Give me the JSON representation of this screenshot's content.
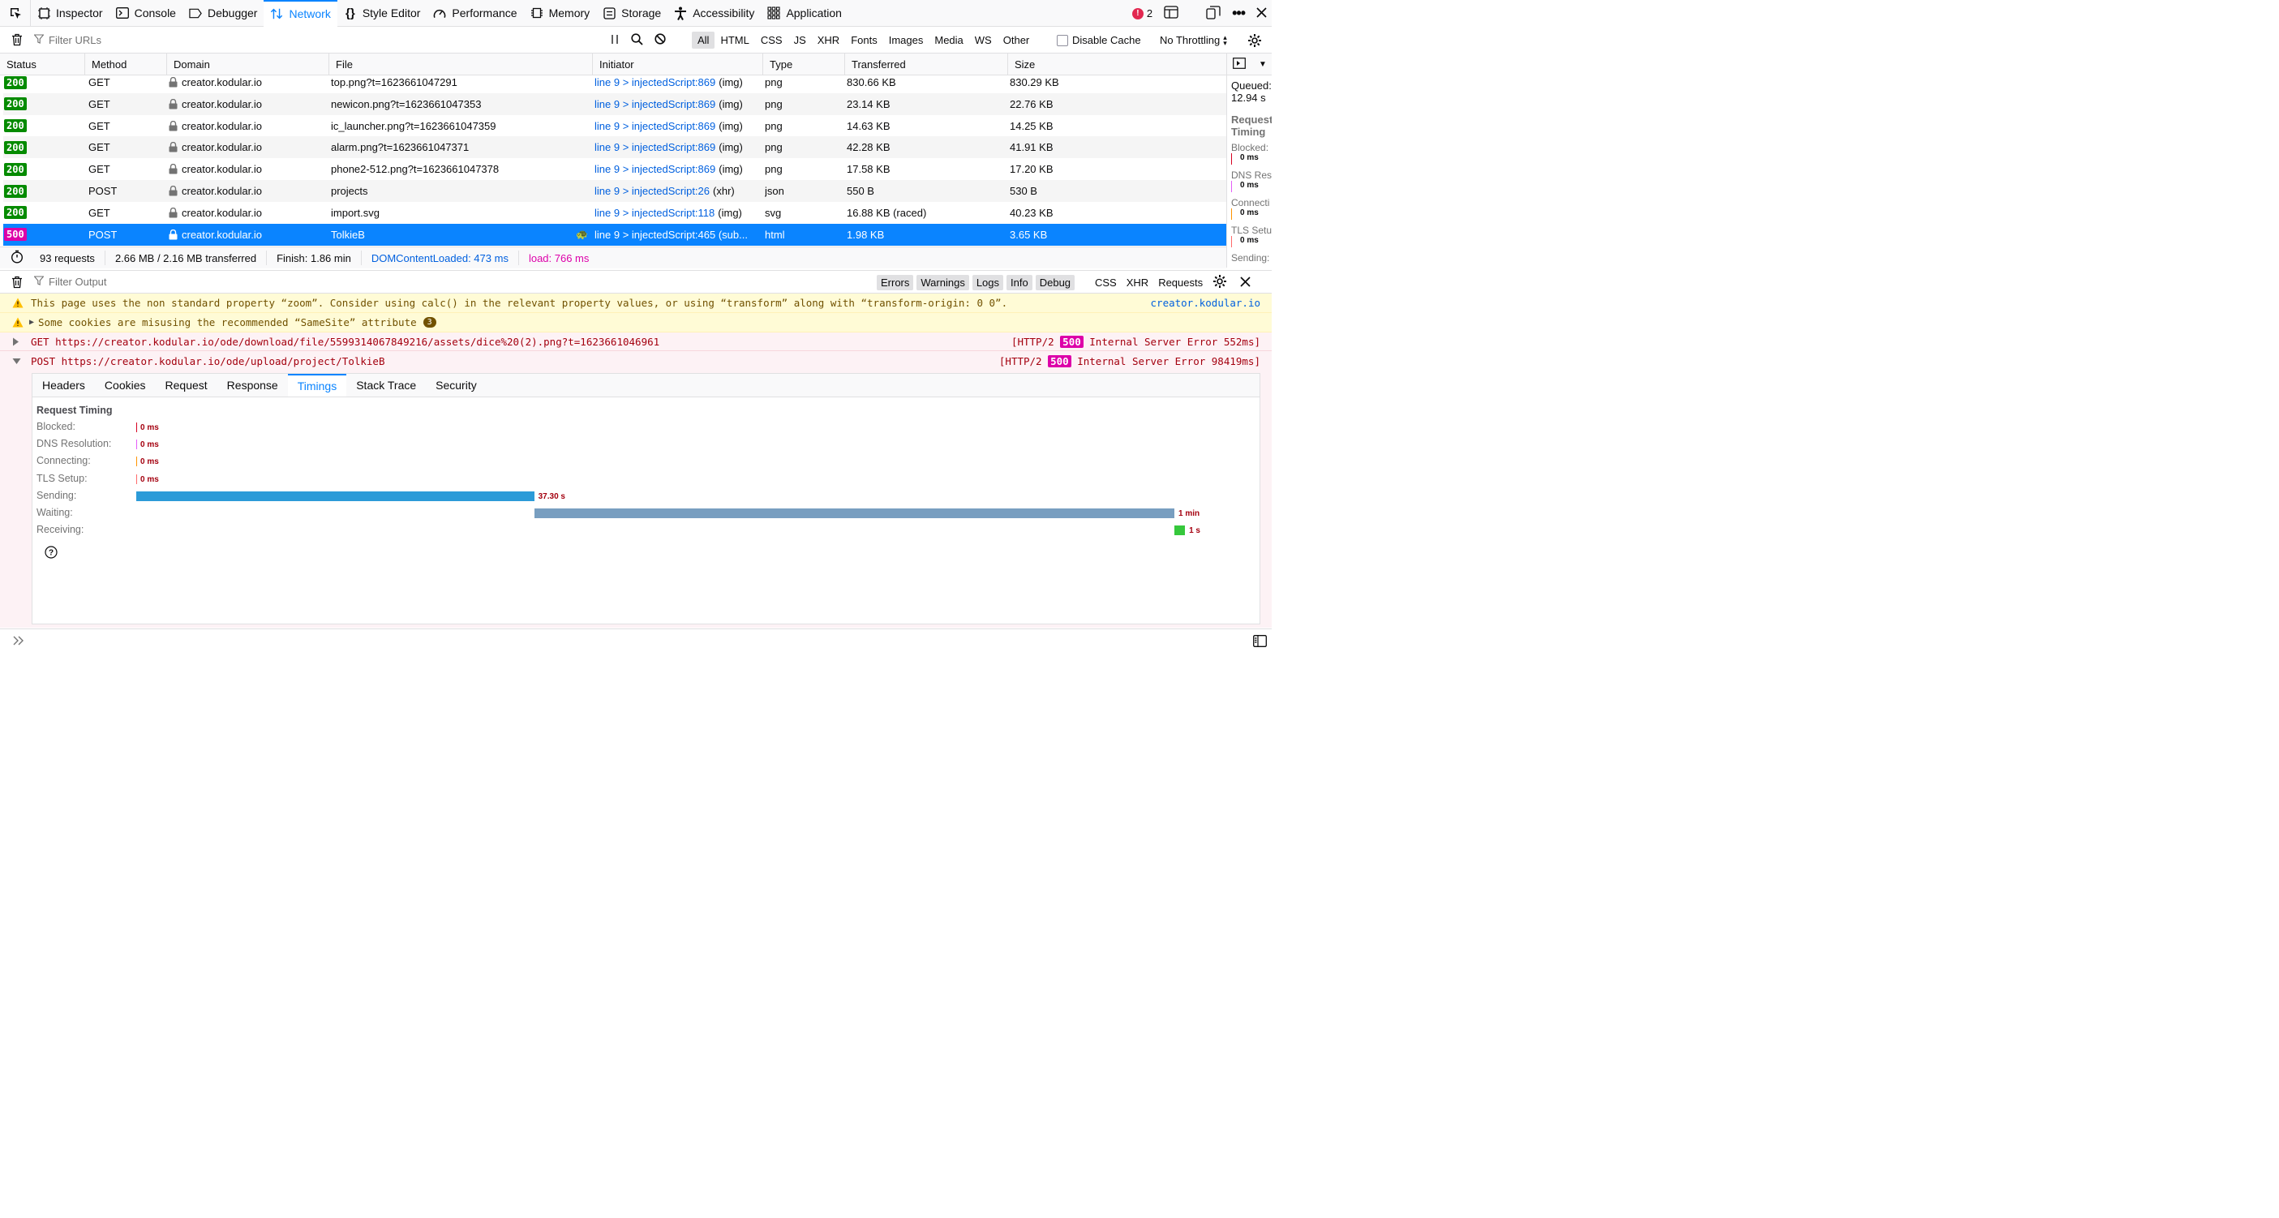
{
  "toolbar": {
    "tabs": [
      {
        "label": "Inspector",
        "icon": "inspector-icon"
      },
      {
        "label": "Console",
        "icon": "console-icon"
      },
      {
        "label": "Debugger",
        "icon": "debugger-icon"
      },
      {
        "label": "Network",
        "icon": "network-icon"
      },
      {
        "label": "Style Editor",
        "icon": "style-editor-icon"
      },
      {
        "label": "Performance",
        "icon": "performance-icon"
      },
      {
        "label": "Memory",
        "icon": "memory-icon"
      },
      {
        "label": "Storage",
        "icon": "storage-icon"
      },
      {
        "label": "Accessibility",
        "icon": "accessibility-icon"
      },
      {
        "label": "Application",
        "icon": "application-icon"
      }
    ],
    "active_tab": "Network",
    "error_count": "2"
  },
  "filterbar": {
    "placeholder": "Filter URLs",
    "types": [
      "All",
      "HTML",
      "CSS",
      "JS",
      "XHR",
      "Fonts",
      "Images",
      "Media",
      "WS",
      "Other"
    ],
    "active_type": "All",
    "disable_cache": "Disable Cache",
    "throttling": "No Throttling"
  },
  "columns": [
    "Status",
    "Method",
    "Domain",
    "File",
    "Initiator",
    "Type",
    "Transferred",
    "Size"
  ],
  "requests": [
    {
      "status": "200",
      "method": "GET",
      "domain": "creator.kodular.io",
      "file": "top.png?t=1623661047291",
      "initiator_link": "line 9 > injectedScript:869",
      "initiator_kind": "(img)",
      "type": "png",
      "transferred": "830.66 KB",
      "size": "830.29 KB"
    },
    {
      "status": "200",
      "method": "GET",
      "domain": "creator.kodular.io",
      "file": "newicon.png?t=1623661047353",
      "initiator_link": "line 9 > injectedScript:869",
      "initiator_kind": "(img)",
      "type": "png",
      "transferred": "23.14 KB",
      "size": "22.76 KB"
    },
    {
      "status": "200",
      "method": "GET",
      "domain": "creator.kodular.io",
      "file": "ic_launcher.png?t=1623661047359",
      "initiator_link": "line 9 > injectedScript:869",
      "initiator_kind": "(img)",
      "type": "png",
      "transferred": "14.63 KB",
      "size": "14.25 KB"
    },
    {
      "status": "200",
      "method": "GET",
      "domain": "creator.kodular.io",
      "file": "alarm.png?t=1623661047371",
      "initiator_link": "line 9 > injectedScript:869",
      "initiator_kind": "(img)",
      "type": "png",
      "transferred": "42.28 KB",
      "size": "41.91 KB"
    },
    {
      "status": "200",
      "method": "GET",
      "domain": "creator.kodular.io",
      "file": "phone2-512.png?t=1623661047378",
      "initiator_link": "line 9 > injectedScript:869",
      "initiator_kind": "(img)",
      "type": "png",
      "transferred": "17.58 KB",
      "size": "17.20 KB"
    },
    {
      "status": "200",
      "method": "POST",
      "domain": "creator.kodular.io",
      "file": "projects",
      "initiator_link": "line 9 > injectedScript:26",
      "initiator_kind": "(xhr)",
      "type": "json",
      "transferred": "550 B",
      "size": "530 B"
    },
    {
      "status": "200",
      "method": "GET",
      "domain": "creator.kodular.io",
      "file": "import.svg",
      "initiator_link": "line 9 > injectedScript:118",
      "initiator_kind": "(img)",
      "type": "svg",
      "transferred": "16.88 KB (raced)",
      "size": "40.23 KB"
    },
    {
      "status": "500",
      "method": "POST",
      "domain": "creator.kodular.io",
      "file": "TolkieB",
      "initiator_link": "line 9 > injectedScript:465 (sub...",
      "initiator_kind": "",
      "type": "html",
      "transferred": "1.98 KB",
      "size": "3.65 KB"
    }
  ],
  "side_panel": {
    "queued_label": "Queued:",
    "queued_value": "12.94 s",
    "request_timing": "Request Timing",
    "rows": [
      {
        "label": "Blocked:",
        "value": "0 ms"
      },
      {
        "label": "DNS Res",
        "value": "0 ms"
      },
      {
        "label": "Connecti",
        "value": "0 ms"
      },
      {
        "label": "TLS Setu",
        "value": "0 ms"
      },
      {
        "label": "Sending:",
        "value": ""
      }
    ]
  },
  "statusbar": {
    "requests": "93 requests",
    "transferred": "2.66 MB / 2.16 MB transferred",
    "finish": "Finish: 1.86 min",
    "dom_content_loaded": "DOMContentLoaded: 473 ms",
    "load": "load: 766 ms"
  },
  "console": {
    "filter_placeholder": "Filter Output",
    "levels": [
      "Errors",
      "Warnings",
      "Logs",
      "Info",
      "Debug"
    ],
    "kinds": [
      "CSS",
      "XHR",
      "Requests"
    ],
    "messages": [
      {
        "kind": "warning",
        "text": "This page uses the non standard property “zoom”. Consider using calc() in the relevant property values, or using “transform” along with “transform-origin: 0 0”.",
        "source": "creator.kodular.io"
      },
      {
        "kind": "warning",
        "text": "Some cookies are misusing the recommended “SameSite” attribute",
        "count": "3"
      },
      {
        "kind": "error",
        "text": "GET https://creator.kodular.io/ode/download/file/5599314067849216/assets/dice%20(2).png?t=1623661046961",
        "proto": "[HTTP/2",
        "code": "500",
        "status": "Internal Server Error 552ms]"
      },
      {
        "kind": "error",
        "text": "POST https://creator.kodular.io/ode/upload/project/TolkieB",
        "proto": "[HTTP/2",
        "code": "500",
        "status": "Internal Server Error 98419ms]"
      }
    ]
  },
  "details": {
    "tabs": [
      "Headers",
      "Cookies",
      "Request",
      "Response",
      "Timings",
      "Stack Trace",
      "Security"
    ],
    "active_tab": "Timings",
    "title": "Request Timing",
    "timings": [
      {
        "label": "Blocked:",
        "value": "0 ms",
        "start_fraction": 0,
        "duration_fraction": 0,
        "color": "#d70022"
      },
      {
        "label": "DNS Resolution:",
        "value": "0 ms",
        "start_fraction": 0,
        "duration_fraction": 0,
        "color": "#e55cf8"
      },
      {
        "label": "Connecting:",
        "value": "0 ms",
        "start_fraction": 0,
        "duration_fraction": 0,
        "color": "#ff9400"
      },
      {
        "label": "TLS Setup:",
        "value": "0 ms",
        "start_fraction": 0,
        "duration_fraction": 0,
        "color": "#ff6a6a"
      },
      {
        "label": "Sending:",
        "value": "37.30 s",
        "start_fraction": 0,
        "duration_fraction": 0.3818,
        "color": "#2c9bd8"
      },
      {
        "label": "Waiting:",
        "value": "1 min",
        "start_fraction": 0.3818,
        "duration_fraction": 0.6143,
        "color": "#789ec0"
      },
      {
        "label": "Receiving:",
        "value": "1 s",
        "start_fraction": 0.9961,
        "duration_fraction": 0.0102,
        "color": "#36c83c"
      }
    ]
  },
  "colors": {
    "accent": "#0a84ff",
    "status_ok": "#058b00",
    "status_error": "#dd00a9"
  }
}
